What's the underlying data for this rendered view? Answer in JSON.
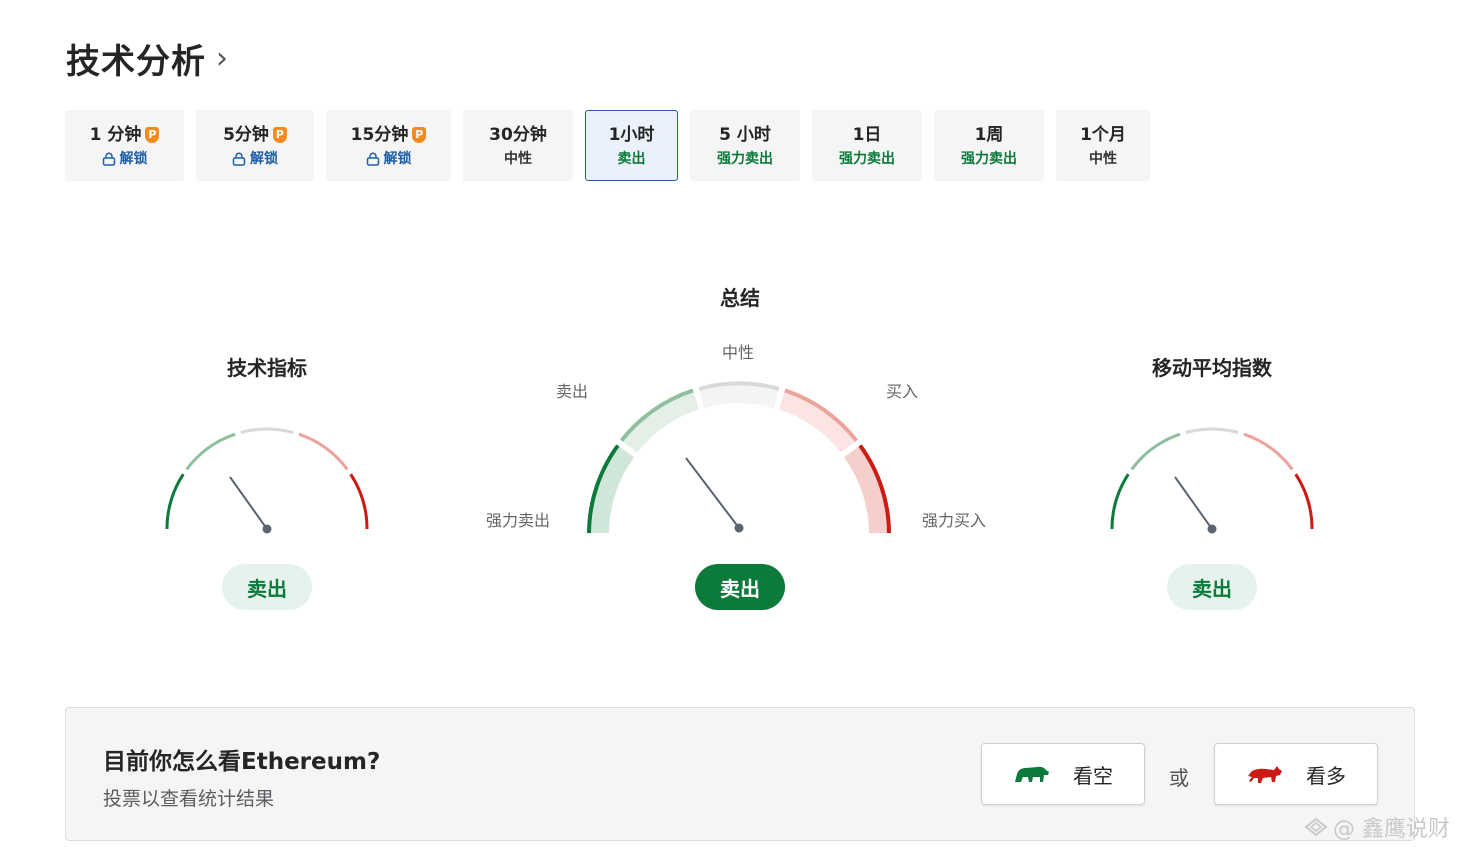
{
  "header": {
    "title": "技术分析",
    "chevron": "›"
  },
  "tabs": [
    {
      "label": "1 分钟",
      "status": "解锁",
      "premium": true,
      "status_type": "unlock"
    },
    {
      "label": "5分钟",
      "status": "解锁",
      "premium": true,
      "status_type": "unlock"
    },
    {
      "label": "15分钟",
      "status": "解锁",
      "premium": true,
      "status_type": "unlock"
    },
    {
      "label": "30分钟",
      "status": "中性",
      "premium": false,
      "status_type": "neutral"
    },
    {
      "label": "1小时",
      "status": "卖出",
      "premium": false,
      "status_type": "sell",
      "active": true
    },
    {
      "label": "5 小时",
      "status": "强力卖出",
      "premium": false,
      "status_type": "sell"
    },
    {
      "label": "1日",
      "status": "强力卖出",
      "premium": false,
      "status_type": "sell"
    },
    {
      "label": "1周",
      "status": "强力卖出",
      "premium": false,
      "status_type": "sell"
    },
    {
      "label": "1个月",
      "status": "中性",
      "premium": false,
      "status_type": "neutral"
    }
  ],
  "premium_badge": "P",
  "gauges": {
    "indicators": {
      "title": "技术指标",
      "result": "卖出"
    },
    "summary": {
      "title": "总结",
      "result": "卖出",
      "labels": {
        "strong_sell": "强力卖出",
        "sell": "卖出",
        "neutral": "中性",
        "buy": "买入",
        "strong_buy": "强力买入"
      }
    },
    "moving_averages": {
      "title": "移动平均指数",
      "result": "卖出"
    }
  },
  "poll": {
    "question": "目前你怎么看Ethereum?",
    "subtitle": "投票以查看统计结果",
    "bearish_label": "看空",
    "or_label": "或",
    "bullish_label": "看多"
  },
  "watermark": "@ 鑫鹰说财",
  "colors": {
    "strong_sell": "#0b7a3a",
    "sell": "#8fbf9f",
    "neutral": "#d9d9d9",
    "buy": "#eba39c",
    "strong_buy": "#cc1a14",
    "needle": "#5b6470",
    "active_tab_border": "#1f5fa8"
  }
}
